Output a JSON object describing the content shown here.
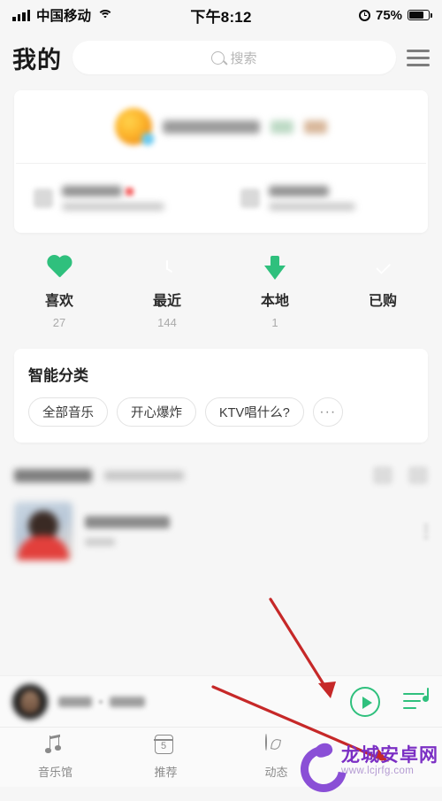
{
  "theme": {
    "accent": "#2fc07d",
    "background": "#f6f6f6",
    "card": "#ffffff",
    "annotation": "#c62828",
    "watermark": "#7b2fc4"
  },
  "status_bar": {
    "carrier": "中国移动",
    "signal_icon": "signal-bars-icon",
    "wifi_icon": "wifi-icon",
    "time": "下午8:12",
    "alarm_icon": "alarm-clock-icon",
    "battery_percent": "75%",
    "battery_icon": "battery-icon",
    "battery_level": 75
  },
  "header": {
    "title": "我的",
    "search": {
      "icon": "search-icon",
      "placeholder": "搜索",
      "value": ""
    },
    "menu_icon": "hamburger-menu-icon"
  },
  "profile_card": {
    "avatar_icon": "user-avatar",
    "username_redacted": "",
    "badges": [
      "",
      ""
    ],
    "entries": [
      {
        "icon": "entry-icon",
        "title_redacted": "",
        "subtitle_redacted": "",
        "has_red_badge": true
      },
      {
        "icon": "entry-icon",
        "title_redacted": "",
        "subtitle_redacted": "",
        "has_red_badge": false
      }
    ]
  },
  "stats": [
    {
      "icon": "heart-icon",
      "label": "喜欢",
      "count": "27"
    },
    {
      "icon": "clock-icon",
      "label": "最近",
      "count": "144"
    },
    {
      "icon": "download-icon",
      "label": "本地",
      "count": "1"
    },
    {
      "icon": "check-circle-icon",
      "label": "已购",
      "count": ""
    }
  ],
  "smart_category": {
    "title": "智能分类",
    "chips": [
      "全部音乐",
      "开心爆炸",
      "KTV唱什么?"
    ],
    "more_label": "···"
  },
  "playlist_section": {
    "header_title_redacted": "",
    "header_count_redacted": "",
    "action_icons": [
      "grid-view-icon",
      "list-view-icon"
    ],
    "rows": [
      {
        "thumbnail": "playlist-cover",
        "title_redacted": "",
        "subtitle_redacted": "",
        "more_icon": "more-vertical-icon"
      }
    ]
  },
  "mini_player": {
    "avatar_icon": "now-playing-avatar",
    "song_redacted": "",
    "artist_redacted": "",
    "play_icon": "play-button-icon",
    "queue_icon": "playlist-queue-icon"
  },
  "tab_bar": [
    {
      "icon": "music-note-icon",
      "label": "音乐馆",
      "active": false
    },
    {
      "icon": "calendar-icon",
      "label": "推荐",
      "badge": "5",
      "active": false
    },
    {
      "icon": "compass-icon",
      "label": "动态",
      "active": false
    },
    {
      "icon": "profile-icon",
      "label": "",
      "active": true
    }
  ],
  "annotations": [
    {
      "name": "arrow-to-play-button",
      "color": "#c62828"
    },
    {
      "name": "arrow-to-profile-tab",
      "color": "#c62828"
    }
  ],
  "watermark": {
    "site_cn": "龙城安卓网",
    "site_url": "www.lcjrfg.com",
    "logo": "dragon-logo"
  }
}
